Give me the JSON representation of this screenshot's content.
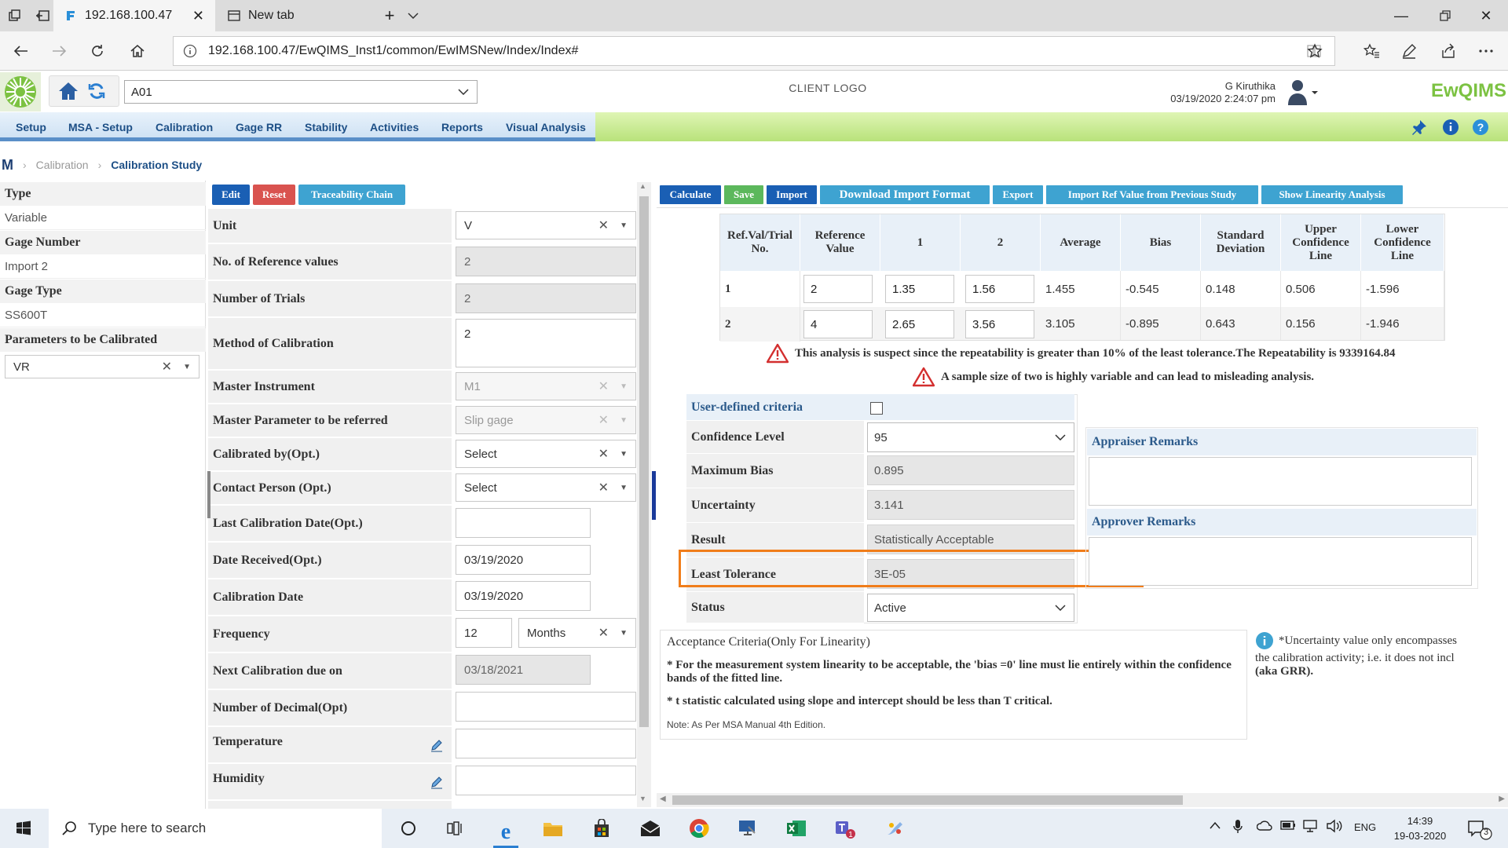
{
  "browser": {
    "tabs": [
      {
        "title": "192.168.100.47"
      },
      {
        "title": "New tab"
      }
    ],
    "url": "192.168.100.47/EwQIMS_Inst1/common/EwIMSNew/Index/Index#"
  },
  "header": {
    "site_select": "A01",
    "client_logo": "CLIENT LOGO",
    "user_name": "G Kiruthika",
    "datetime": "03/19/2020 2:24:07 pm",
    "brand": "EwQIMS"
  },
  "menu": {
    "items": [
      "Setup",
      "MSA - Setup",
      "Calibration",
      "Gage RR",
      "Stability",
      "Activities",
      "Reports",
      "Visual Analysis"
    ]
  },
  "breadcrumb": {
    "root": "Calibration",
    "current": "Calibration Study"
  },
  "left_panel": {
    "type_label": "Type",
    "type_value": "Variable",
    "gage_number_label": "Gage Number",
    "gage_number_value": "Import 2",
    "gage_type_label": "Gage Type",
    "gage_type_value": "SS600T",
    "params_label": "Parameters to be Calibrated",
    "params_value": "VR"
  },
  "form": {
    "buttons": {
      "edit": "Edit",
      "reset": "Reset",
      "trace": "Traceability Chain"
    },
    "unit_label": "Unit",
    "unit_value": "V",
    "ref_values_label": "No. of Reference values",
    "ref_values_value": "2",
    "trials_label": "Number of Trials",
    "trials_value": "2",
    "method_label": "Method of Calibration",
    "method_value": "2",
    "master_instr_label": "Master Instrument",
    "master_instr_value": "M1",
    "master_param_label": "Master Parameter to be referred",
    "master_param_value": "Slip gage",
    "calibrated_by_label": "Calibrated by(Opt.)",
    "calibrated_by_value": "Select",
    "contact_label": "Contact Person (Opt.)",
    "contact_value": "Select",
    "last_cal_label": "Last Calibration Date(Opt.)",
    "last_cal_value": "",
    "date_received_label": "Date Received(Opt.)",
    "date_received_value": "03/19/2020",
    "cal_date_label": "Calibration Date",
    "cal_date_value": "03/19/2020",
    "frequency_label": "Frequency",
    "frequency_value": "12",
    "frequency_unit": "Months",
    "next_cal_label": "Next Calibration due on",
    "next_cal_value": "03/18/2021",
    "decimal_label": "Number of Decimal(Opt)",
    "decimal_value": "",
    "temperature_label": "Temperature",
    "temperature_value": "",
    "humidity_label": "Humidity",
    "humidity_value": ""
  },
  "actions": {
    "calculate": "Calculate",
    "save": "Save",
    "import": "Import",
    "download_format": "Download Import Format",
    "export": "Export",
    "import_prev": "Import Ref Value from Previous Study",
    "show_linearity": "Show Linearity Analysis"
  },
  "results_table": {
    "headers": [
      "Ref.Val/Trial No.",
      "Reference Value",
      "1",
      "2",
      "Average",
      "Bias",
      "Standard Deviation",
      "Upper Confidence Line",
      "Lower Confidence Line"
    ],
    "rows": [
      {
        "no": "1",
        "ref": "2",
        "t1": "1.35",
        "t2": "1.56",
        "avg": "1.455",
        "bias": "-0.545",
        "sd": "0.148",
        "ucl": "0.506",
        "lcl": "-1.596"
      },
      {
        "no": "2",
        "ref": "4",
        "t1": "2.65",
        "t2": "3.56",
        "avg": "3.105",
        "bias": "-0.895",
        "sd": "0.643",
        "ucl": "0.156",
        "lcl": "-1.946"
      }
    ]
  },
  "warnings": {
    "w1": "This analysis is suspect since the repeatability is greater than 10% of the least tolerance.The Repeatability is 9339164.84",
    "w2": "A sample size of two is highly variable and can lead to misleading analysis."
  },
  "criteria": {
    "user_defined_label": "User-defined criteria",
    "confidence_label": "Confidence Level",
    "confidence_value": "95",
    "max_bias_label": "Maximum Bias",
    "max_bias_value": "0.895",
    "uncertainty_label": "Uncertainty",
    "uncertainty_value": "3.141",
    "result_label": "Result",
    "result_value": "Statistically Acceptable",
    "least_tol_label": "Least Tolerance",
    "least_tol_value": "3E-05",
    "status_label": "Status",
    "status_value": "Active"
  },
  "remarks": {
    "appraiser_label": "Appraiser Remarks",
    "approver_label": "Approver Remarks"
  },
  "acceptance": {
    "title": "Acceptance Criteria(Only For Linearity)",
    "line1": "* For the measurement system linearity to be acceptable, the 'bias =0' line must lie entirely within the confidence bands of the fitted line.",
    "line2": "* t statistic calculated using slope and intercept should be less than T critical.",
    "note": "Note: As Per MSA Manual 4th Edition."
  },
  "info_note": {
    "line1": "*Uncertainty value only encompasses",
    "line2": "the calibration activity; i.e. it does not incl",
    "line3": "(aka GRR)."
  },
  "taskbar": {
    "search_placeholder": "Type here to search",
    "lang": "ENG",
    "time": "14:39",
    "date": "19-03-2020",
    "notif_count": "3"
  },
  "colors": {
    "menu_text": "#1d4f86",
    "btn_blue": "#1a5fb4",
    "btn_red": "#d9534f",
    "btn_green": "#5cb85c",
    "btn_teal": "#3ea3d1",
    "highlight_orange": "#f07d1a"
  }
}
